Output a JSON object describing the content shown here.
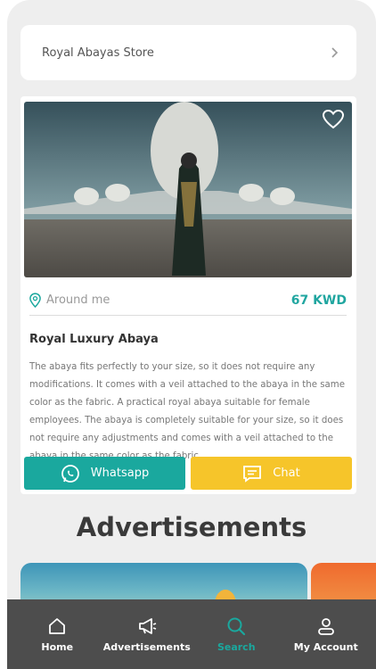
{
  "store": {
    "name": "Royal Abayas Store"
  },
  "product": {
    "location": "Around me",
    "price": "67 KWD",
    "title": "Royal Luxury Abaya",
    "description": "The abaya fits perfectly to your size, so it does not require any modifications. It comes with a veil attached to the abaya in the same color as the fabric. A practical royal abaya suitable for female employees. The abaya is completely suitable for your size, so it does not require any adjustments and comes with a veil attached to the abaya in the same color as the fabric."
  },
  "actions": {
    "whatsapp_label": "Whatsapp",
    "chat_label": "Chat"
  },
  "ads": {
    "heading": "Advertisements"
  },
  "tabbar": {
    "home": "Home",
    "advertisements": "Advertisements",
    "search": "Search",
    "account": "My Account"
  },
  "colors": {
    "accent": "#1aa89e",
    "chat": "#f6c52a",
    "tabbar": "#4d4d4d"
  }
}
